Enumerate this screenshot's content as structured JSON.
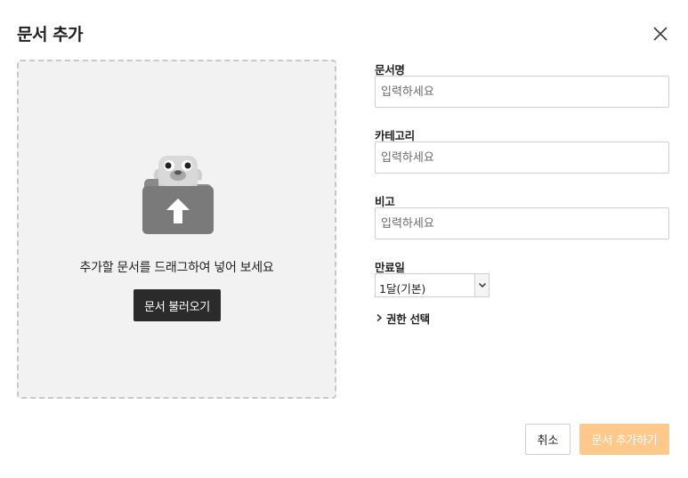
{
  "dialog": {
    "title": "문서 추가",
    "close_icon": "close-icon"
  },
  "dropzone": {
    "icon": "folder-upload-mascot-icon",
    "text": "추가할 문서를 드래그하여 넣어 보세요",
    "load_button": "문서 불러오기"
  },
  "form": {
    "name": {
      "label": "문서명",
      "placeholder": "입력하세요"
    },
    "category": {
      "label": "카테고리",
      "placeholder": "입력하세요"
    },
    "note": {
      "label": "비고",
      "placeholder": "입력하세요"
    },
    "expiry": {
      "label": "만료일",
      "selected": "1달(기본)"
    },
    "permission_toggle": "권한 선택"
  },
  "footer": {
    "cancel_label": "취소",
    "submit_label": "문서 추가하기"
  },
  "colors": {
    "submit_disabled": "#ffc98b",
    "load_button_bg": "#2b2b2b",
    "dropzone_bg": "#f2f2f2"
  }
}
